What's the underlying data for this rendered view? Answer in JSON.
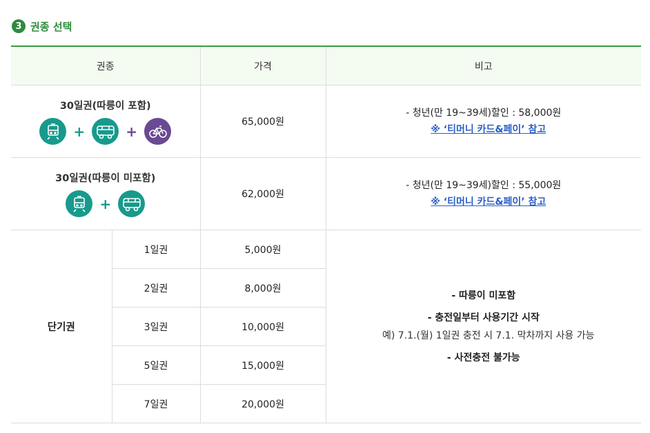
{
  "section": {
    "step_number": "3",
    "title": "권종 선택"
  },
  "table": {
    "headers": [
      "권종",
      "가격",
      "비고"
    ],
    "rows_30day": [
      {
        "name": "30일권(따릉이 포함)",
        "price": "65,000원",
        "icons": [
          "tram-icon",
          "bus-icon",
          "bicycle-icon"
        ],
        "note_dash": "- 청년(만 19~39세)할인 : 58,000원",
        "note_link": "※ ‘티머니 카드&페이’ 참고"
      },
      {
        "name": "30일권(따릉이 미포함)",
        "price": "62,000원",
        "icons": [
          "tram-icon",
          "bus-icon"
        ],
        "note_dash": "- 청년(만 19~39세)할인 : 55,000원",
        "note_link": "※ ‘티머니 카드&페이’ 참고"
      }
    ],
    "short_term": {
      "label": "단기권",
      "items": [
        {
          "name": "1일권",
          "price": "5,000원"
        },
        {
          "name": "2일권",
          "price": "8,000원"
        },
        {
          "name": "3일권",
          "price": "10,000원"
        },
        {
          "name": "5일권",
          "price": "15,000원"
        },
        {
          "name": "7일권",
          "price": "20,000원"
        }
      ],
      "notes": {
        "line1": "- 따릉이 미포함",
        "line2": "- 충전일부터 사용기간 시작",
        "line2_sub": "예) 7.1.(월) 1일권 충전 시 7.1. 막차까지 사용 가능",
        "line3": "- 사전충전 불가능"
      }
    }
  },
  "colors": {
    "accent_green": "#2e8b3d",
    "icon_teal": "#179a8c",
    "icon_purple": "#6a4a92",
    "link_blue": "#2b5fc7",
    "header_bg": "#f4fbf1"
  }
}
